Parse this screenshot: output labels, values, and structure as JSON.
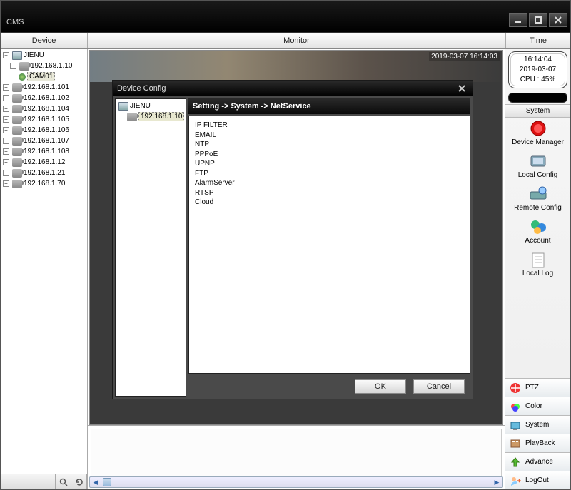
{
  "title": "CMS",
  "header": {
    "device": "Device",
    "monitor": "Monitor",
    "time": "Time"
  },
  "sidebar": {
    "root": "JIENU",
    "rootip": "192.168.1.10",
    "cam": "CAM01",
    "devices": [
      "192.168.1.101",
      "192.168.1.102",
      "192.168.1.104",
      "192.168.1.105",
      "192.168.1.106",
      "192.168.1.107",
      "192.168.1.108",
      "192.168.1.12",
      "192.168.1.21",
      "192.168.1.70"
    ]
  },
  "video": {
    "timestamp": "2019-03-07 16:14:03"
  },
  "clock": {
    "time": "16:14:04",
    "date": "2019-03-07",
    "cpu": "CPU : 45%"
  },
  "system": {
    "title": "System",
    "items": [
      {
        "label": "Device Manager",
        "icon": "record"
      },
      {
        "label": "Local Config",
        "icon": "localcfg"
      },
      {
        "label": "Remote Config",
        "icon": "remotecfg"
      },
      {
        "label": "Account",
        "icon": "account"
      },
      {
        "label": "Local Log",
        "icon": "log"
      }
    ]
  },
  "tabs": [
    {
      "label": "PTZ",
      "icon": "ptz"
    },
    {
      "label": "Color",
      "icon": "color"
    },
    {
      "label": "System",
      "icon": "sys"
    },
    {
      "label": "PlayBack",
      "icon": "playback"
    },
    {
      "label": "Advance",
      "icon": "advance"
    },
    {
      "label": "LogOut",
      "icon": "logout"
    }
  ],
  "modal": {
    "title": "Device Config",
    "tree_root": "JIENU",
    "tree_ip": "192.168.1.10",
    "breadcrumb": "Setting -> System -> NetService",
    "items": [
      "IP FILTER",
      "EMAIL",
      "NTP",
      "PPPoE",
      "UPNP",
      "FTP",
      "AlarmServer",
      "RTSP",
      "Cloud"
    ],
    "ok": "OK",
    "cancel": "Cancel"
  }
}
